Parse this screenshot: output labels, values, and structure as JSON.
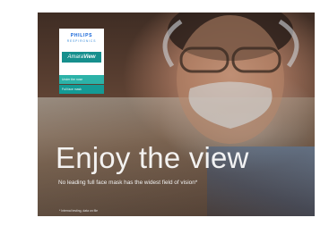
{
  "logo": {
    "brand": "PHILIPS",
    "sub_brand": "RESPIRONICS",
    "product_prefix": "Amara",
    "product_suffix": "View"
  },
  "tags": [
    "Under the nose",
    "Full face mask"
  ],
  "headline": "Enjoy the view",
  "tagline": "No leading full face mask has the widest field of vision*",
  "footnote": "* Internal testing, data on file",
  "colors": {
    "teal_dark": "#168f8d",
    "teal_light": "#2cb2a8",
    "philips_blue": "#0b5ed7"
  }
}
